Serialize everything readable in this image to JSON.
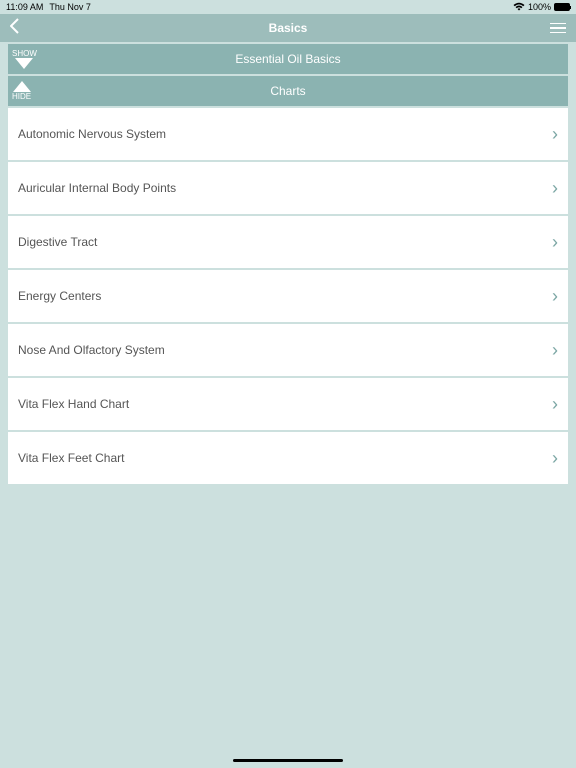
{
  "status": {
    "time": "11:09 AM",
    "date": "Thu Nov 7",
    "battery": "100%"
  },
  "nav": {
    "title": "Basics"
  },
  "sections": {
    "s1": {
      "toggle": "SHOW",
      "title": "Essential Oil Basics"
    },
    "s2": {
      "toggle": "HIDE",
      "title": "Charts"
    }
  },
  "items": [
    {
      "label": "Autonomic Nervous System"
    },
    {
      "label": "Auricular Internal Body Points"
    },
    {
      "label": "Digestive Tract"
    },
    {
      "label": "Energy Centers"
    },
    {
      "label": "Nose And Olfactory System"
    },
    {
      "label": "Vita Flex Hand Chart"
    },
    {
      "label": "Vita Flex Feet Chart"
    }
  ]
}
